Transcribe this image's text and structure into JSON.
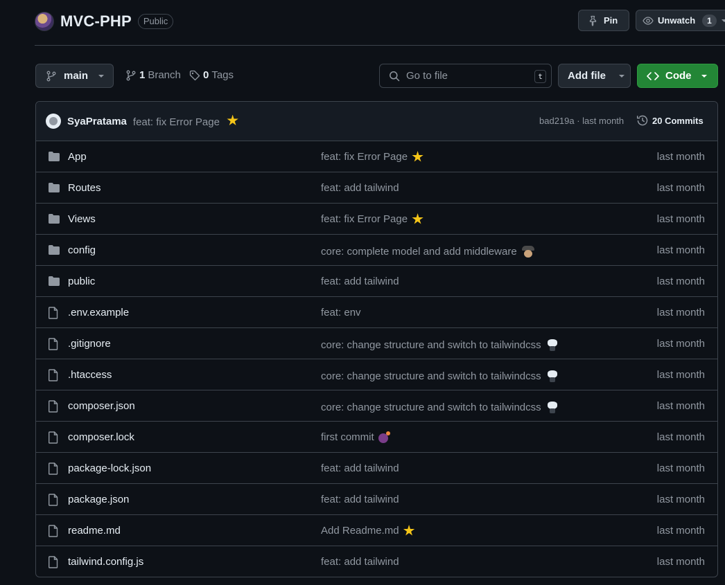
{
  "repo": {
    "name": "MVC-PHP",
    "visibility": "Public"
  },
  "actions": {
    "pin_label": "Pin",
    "watch_label": "Unwatch",
    "watch_count": "1"
  },
  "toolbar": {
    "branch": "main",
    "branches_count": "1",
    "branches_label": "Branch",
    "tags_count": "0",
    "tags_label": "Tags",
    "goto_placeholder": "Go to file",
    "goto_shortcut": "t",
    "add_file_label": "Add file",
    "code_label": "Code"
  },
  "latest_commit": {
    "author": "SyaPratama",
    "message": "feat: fix Error Page",
    "message_emoji": "star",
    "meta": "bad219a · last month",
    "commits_count": "20",
    "commits_label": "Commits"
  },
  "files": [
    {
      "name": "App",
      "type": "folder",
      "message": "feat: fix Error Page",
      "emoji": "star",
      "time": "last month"
    },
    {
      "name": "Routes",
      "type": "folder",
      "message": "feat: add tailwind",
      "emoji": "",
      "time": "last month"
    },
    {
      "name": "Views",
      "type": "folder",
      "message": "feat: fix Error Page",
      "emoji": "star",
      "time": "last month"
    },
    {
      "name": "config",
      "type": "folder",
      "message": "core: complete model and add middleware",
      "emoji": "spy",
      "time": "last month"
    },
    {
      "name": "public",
      "type": "folder",
      "message": "feat: add tailwind",
      "emoji": "",
      "time": "last month"
    },
    {
      "name": ".env.example",
      "type": "file",
      "message": "feat: env",
      "emoji": "",
      "time": "last month"
    },
    {
      "name": ".gitignore",
      "type": "file",
      "message": "core: change structure and switch to tailwindcss",
      "emoji": "octocat",
      "time": "last month"
    },
    {
      "name": ".htaccess",
      "type": "file",
      "message": "core: change structure and switch to tailwindcss",
      "emoji": "octocat",
      "time": "last month"
    },
    {
      "name": "composer.json",
      "type": "file",
      "message": "core: change structure and switch to tailwindcss",
      "emoji": "octocat",
      "time": "last month"
    },
    {
      "name": "composer.lock",
      "type": "file",
      "message": "first commit",
      "emoji": "bomb",
      "time": "last month"
    },
    {
      "name": "package-lock.json",
      "type": "file",
      "message": "feat: add tailwind",
      "emoji": "",
      "time": "last month"
    },
    {
      "name": "package.json",
      "type": "file",
      "message": "feat: add tailwind",
      "emoji": "",
      "time": "last month"
    },
    {
      "name": "readme.md",
      "type": "file",
      "message": "Add Readme.md",
      "emoji": "star",
      "time": "last month"
    },
    {
      "name": "tailwind.config.js",
      "type": "file",
      "message": "feat: add tailwind",
      "emoji": "",
      "time": "last month"
    }
  ],
  "colors": {
    "background": "#0d1117",
    "border": "#3d444d",
    "text": "#e6edf3",
    "muted": "#9198a1",
    "code_button": "#238636"
  }
}
